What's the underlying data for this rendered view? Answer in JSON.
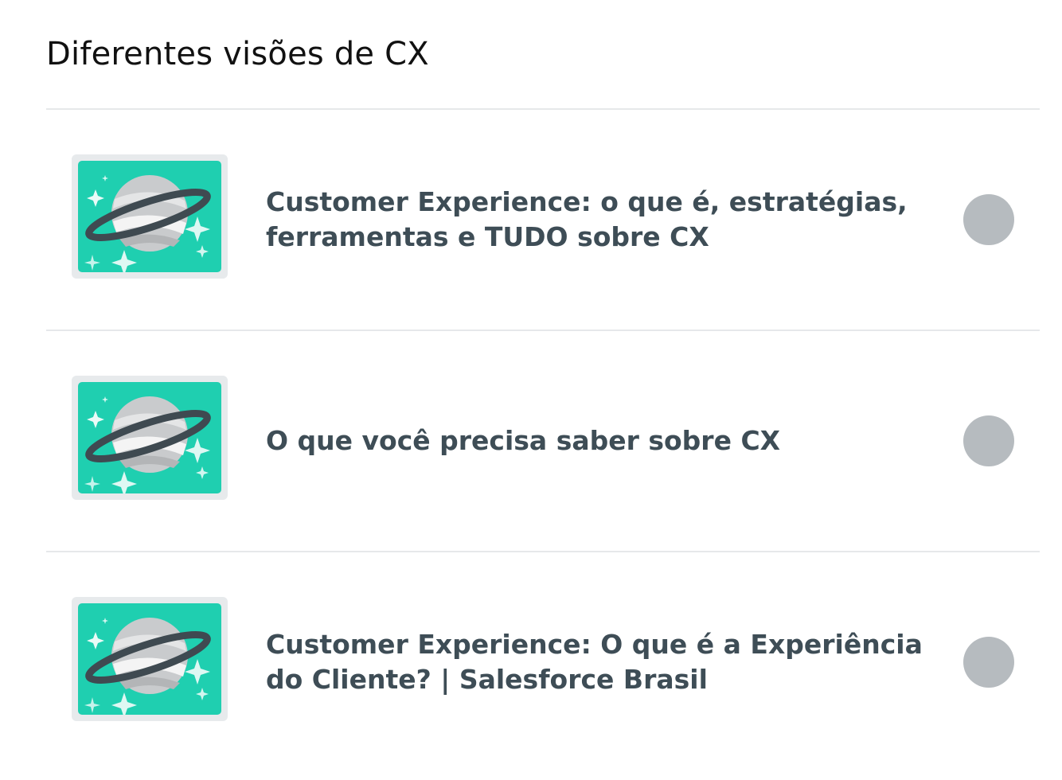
{
  "section": {
    "title": "Diferentes visões de CX"
  },
  "items": [
    {
      "title": "Customer Experience: o que é, estratégias, ferramentas e TUDO sobre CX",
      "thumbnail_icon": "planet-icon",
      "status_icon": "incomplete-status-icon"
    },
    {
      "title": "O que você precisa saber sobre CX",
      "thumbnail_icon": "planet-icon",
      "status_icon": "incomplete-status-icon"
    },
    {
      "title": "Customer Experience: O que é a Experiência do Cliente? | Salesforce Brasil",
      "thumbnail_icon": "planet-icon",
      "status_icon": "incomplete-status-icon"
    }
  ],
  "colors": {
    "thumbnail_background": "#1fcfb0",
    "title_text": "#3e4d56",
    "status_dot": "#b6bbbf",
    "divider": "#e6e8ea"
  }
}
